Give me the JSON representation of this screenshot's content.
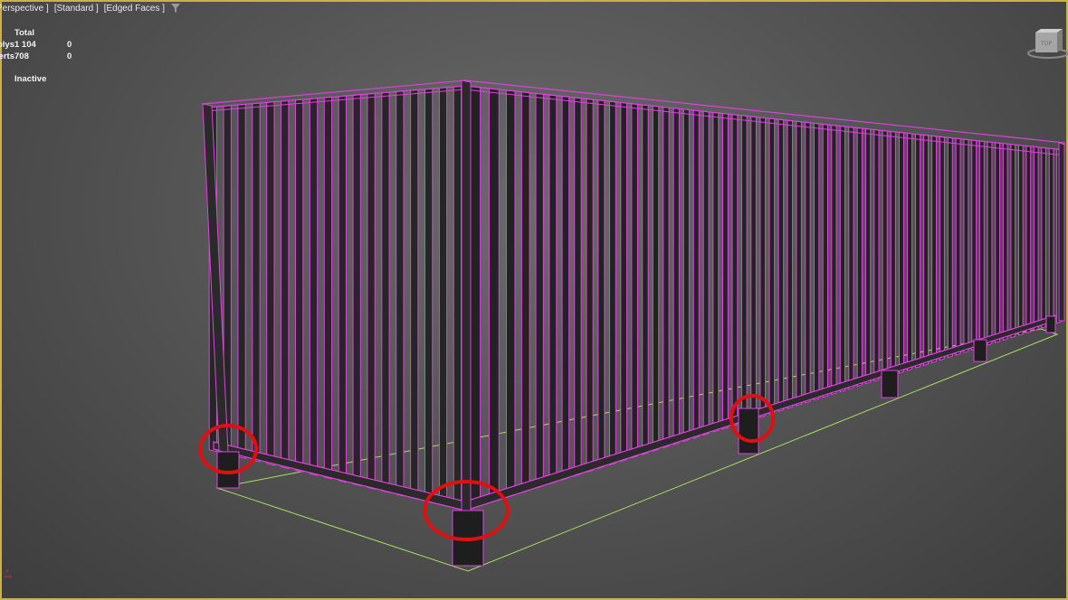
{
  "viewport": {
    "label_segments": [
      "Perspective ]",
      "[Standard ]",
      "[Edged Faces ]"
    ],
    "filter_icon": "funnel-icon",
    "state": "Inactive"
  },
  "stats": {
    "header": "Total",
    "rows": [
      {
        "label": "Polys:",
        "total": "1 104",
        "selected": "0"
      },
      {
        "label": "Verts:",
        "total": "708",
        "selected": "0"
      }
    ]
  },
  "colors": {
    "wireframe": "#e040e0",
    "ground_outline": "#a8e060",
    "highlight_circle": "#e01010",
    "viewport_border": "#c8b24a"
  }
}
